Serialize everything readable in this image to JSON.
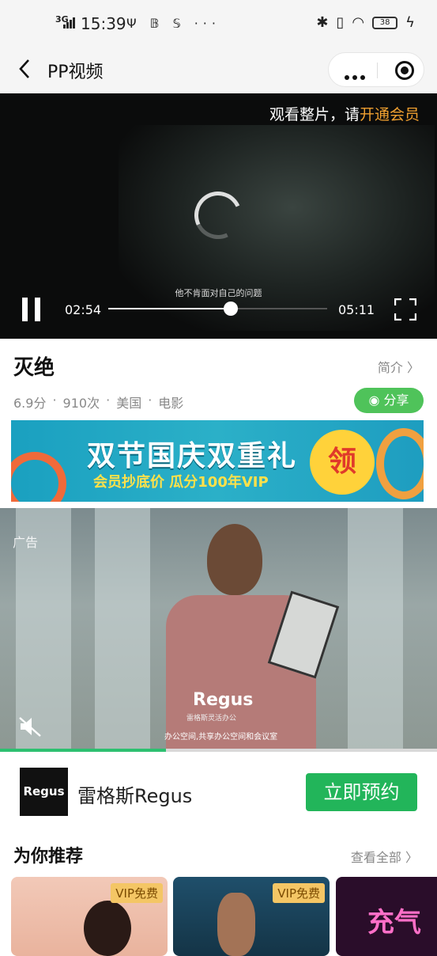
{
  "status_bar": {
    "network": "3G",
    "time": "15:39",
    "left_icons": "Ψ 𝔹 𝕊 ···",
    "battery": "38"
  },
  "header": {
    "title": "PP视频"
  },
  "player": {
    "vip_prompt": "观看整片，请",
    "vip_link": "开通会员",
    "subtitle": "他不肯面对自己的问题",
    "current_time": "02:54",
    "total_time": "05:11",
    "progress": 0.56
  },
  "movie": {
    "title": "灭绝",
    "intro_label": "简介 〉",
    "score": "6.9分",
    "views": "910次",
    "region": "美国",
    "category": "电影",
    "dot": "·",
    "share_label": "分享"
  },
  "banner": {
    "headline": "双节国庆双重礼",
    "subline": "会员抄底价  瓜分100年VIP",
    "coin": "领"
  },
  "ad": {
    "label": "广告",
    "logo": "Regus",
    "logo_sub": "雷格斯灵活办公",
    "tagline": "办公空间,共享办公空间和会议室",
    "progress": 0.38
  },
  "advertiser": {
    "logo": "Regus",
    "name": "雷格斯Regus",
    "cta": "立即预约"
  },
  "recommend": {
    "title": "为你推荐",
    "view_all": "查看全部 〉",
    "cards": [
      {
        "badge": "VIP免费"
      },
      {
        "badge": "VIP免费"
      },
      {
        "badge": "",
        "neon": "充气"
      }
    ]
  },
  "colors": {
    "accent_green": "#22b55a",
    "share_green": "#4fc35a",
    "vip_orange": "#f0a030"
  }
}
